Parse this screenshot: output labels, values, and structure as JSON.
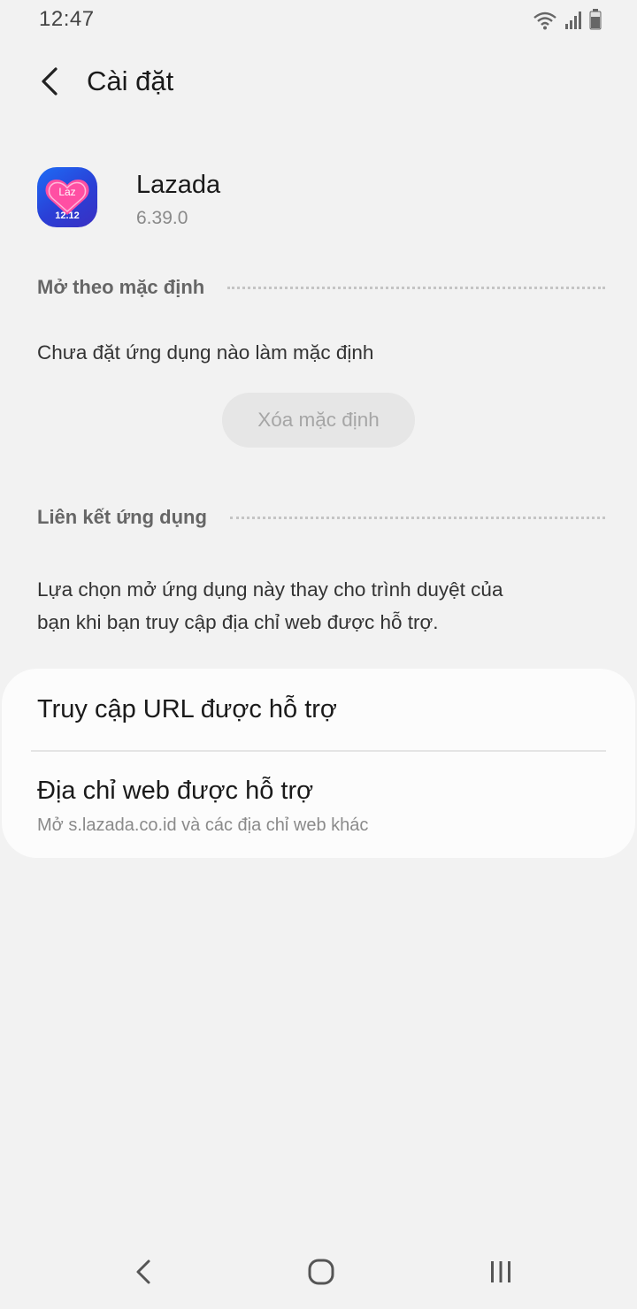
{
  "status_bar": {
    "time": "12:47",
    "icons": [
      "wifi-icon",
      "signal-icon",
      "battery-icon"
    ]
  },
  "header": {
    "back_icon": "chevron-left-icon",
    "title": "Cài đặt"
  },
  "app": {
    "name": "Lazada",
    "version": "6.39.0",
    "icon_text_top": "Laz",
    "icon_text_bottom": "12.12",
    "icon_colors": [
      "#1e6cf5",
      "#3a2fc2",
      "#ff4fa3"
    ]
  },
  "open_by_default": {
    "section_label": "Mở theo mặc định",
    "status_text": "Chưa đặt ứng dụng nào làm mặc định",
    "clear_button_label": "Xóa mặc định"
  },
  "app_links": {
    "section_label": "Liên kết ứng dụng",
    "description_line1": "Lựa chọn mở ứng dụng này thay cho trình duyệt của",
    "description_line2": "bạn khi bạn truy cập địa chỉ web được hỗ trợ.",
    "items": [
      {
        "title": "Truy cập URL được hỗ trợ"
      },
      {
        "title": "Địa chỉ web được hỗ trợ",
        "subtitle": "Mở s.lazada.co.id và các địa chỉ web khác"
      }
    ]
  },
  "nav_bar": {
    "buttons": [
      "back-nav-icon",
      "home-nav-icon",
      "recents-nav-icon"
    ]
  }
}
